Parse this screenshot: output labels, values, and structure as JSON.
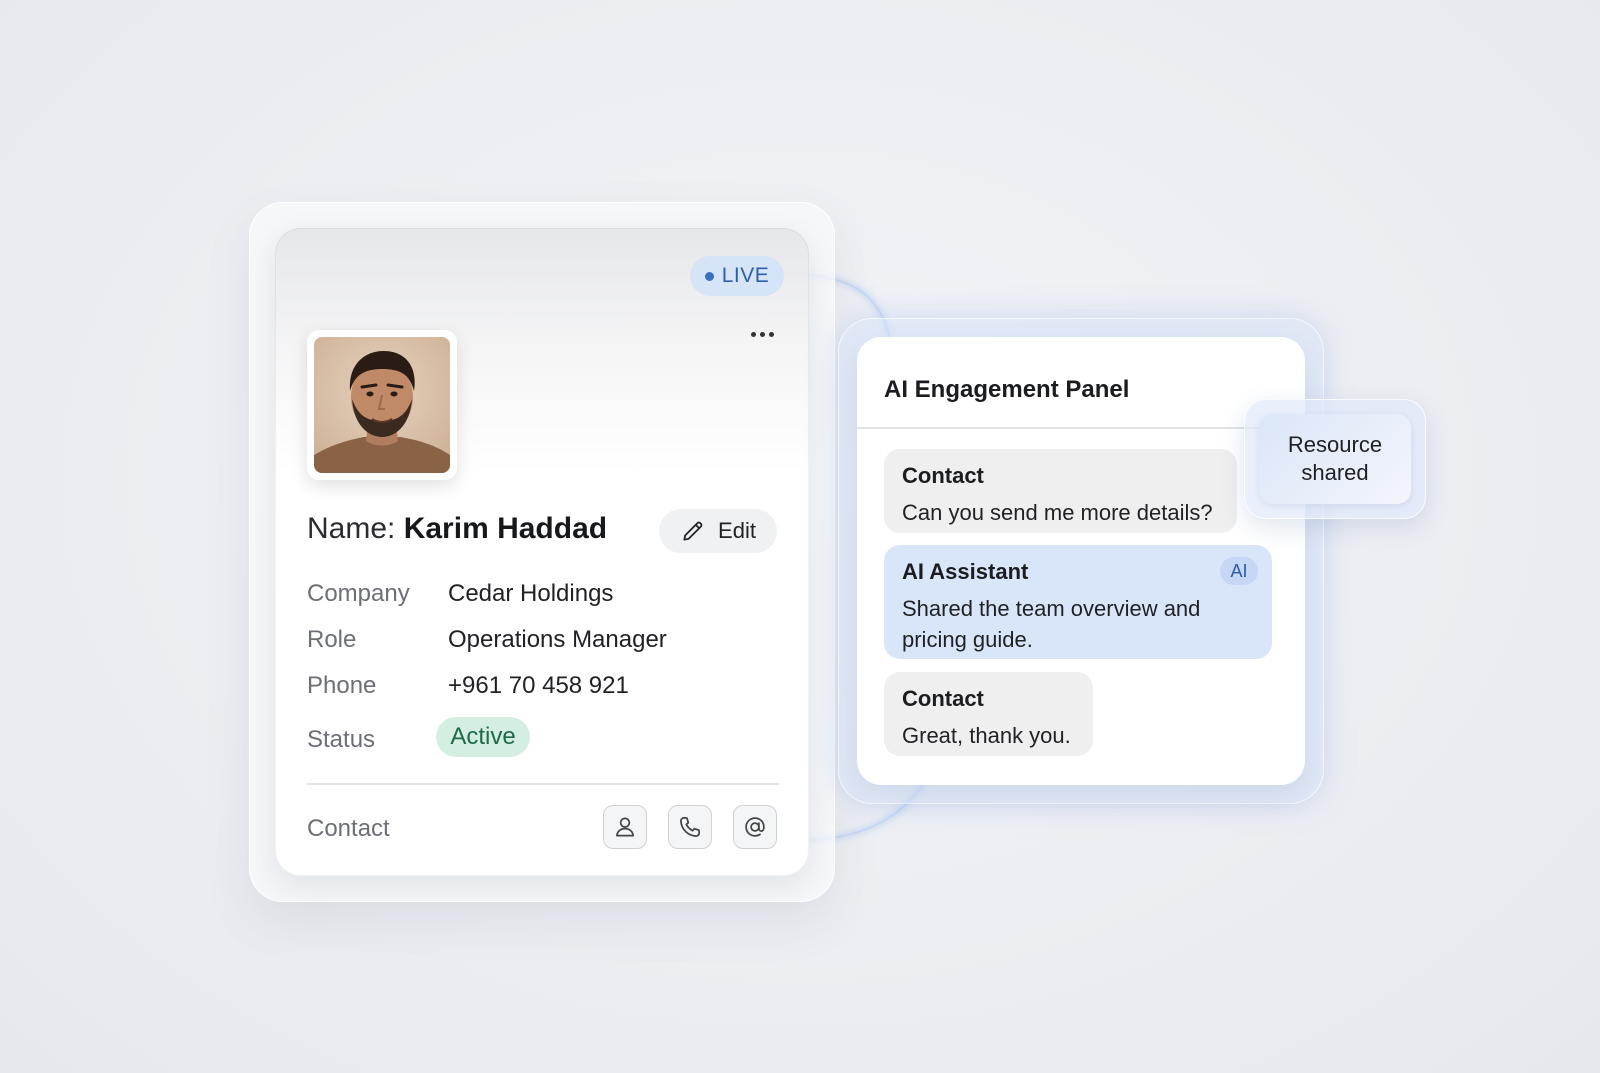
{
  "contact_card": {
    "live_label": "LIVE",
    "name_prefix": "Name:",
    "name": "Karim Haddad",
    "edit_label": "Edit",
    "fields": [
      {
        "label": "Company",
        "value": "Cedar Holdings"
      },
      {
        "label": "Role",
        "value": "Operations Manager"
      },
      {
        "label": "Phone",
        "value": "+961 70 458 921"
      },
      {
        "label": "Status",
        "value": "Active"
      }
    ],
    "footer_label": "Contact",
    "action_icons": [
      "user-icon",
      "phone-icon",
      "at-sign-icon"
    ]
  },
  "ai_panel": {
    "title": "AI Engagement Panel",
    "messages": [
      {
        "sender": "Contact",
        "text": "Can you send me more details?"
      },
      {
        "sender": "AI Assistant",
        "tag": "AI",
        "text": "Shared the team overview and pricing guide."
      },
      {
        "sender": "Contact",
        "text": "Great, thank you."
      }
    ]
  },
  "toast": {
    "text": "Resource shared"
  },
  "colors": {
    "live_pill": "#d6e4f8",
    "status_active": "#d4efe1",
    "ai_message": "#d9e6fa"
  }
}
